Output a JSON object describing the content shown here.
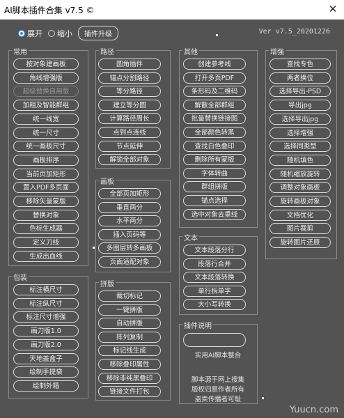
{
  "window": {
    "title": "AI脚本插件合集 v7.5 ©",
    "close_label": "✕"
  },
  "top": {
    "expand_label": "展开",
    "collapse_label": "缩小",
    "upgrade_label": "插件升级",
    "version": "Ver v7.5_20201226"
  },
  "groups": {
    "common": {
      "title": "常用",
      "items": [
        "按对象建画板",
        "角线增强版",
        "超级替换自用版",
        "加粗及智能群组",
        "统一线宽",
        "统一尺寸",
        "统一画板尺寸",
        "画板排序",
        "当前页加矩形",
        "置入PDF多页面",
        "移除矢量蒙版",
        "替换对象",
        "色标生成器",
        "定义刀线",
        "生成出血线"
      ]
    },
    "package": {
      "title": "包装",
      "items": [
        "标注横尺寸",
        "标注纵尺寸",
        "标注尺寸增强",
        "画刀版1.0",
        "画刀版2.0",
        "天地盖盒子",
        "绘制手提袋",
        "绘制外箱"
      ]
    },
    "path": {
      "title": "路径",
      "items": [
        "圆角插件",
        "锚点分割路径",
        "等分路径",
        "建立等分圆",
        "计算路径周长",
        "点到点连线",
        "节点延伸",
        "解锁全部对象"
      ]
    },
    "artboard": {
      "title": "画板",
      "items": [
        "全部页加矩形",
        "垂直两分",
        "水平两分",
        "插入页码等",
        "多图层转多画板",
        "页面适配对象"
      ]
    },
    "imposition": {
      "title": "拼版",
      "items": [
        "裁切标记",
        "一键拼版",
        "自动拼版",
        "阵列复制",
        "标记线生成",
        "移除叠印属性",
        "移除非纯黑叠印",
        "链接文件打包"
      ]
    },
    "other": {
      "title": "其他",
      "items": [
        "创建参考线",
        "打开多页PDF",
        "条形码及二维码",
        "解散全部群组",
        "批量替换链接图",
        "全部颜色转黑",
        "查找白色叠印",
        "删除所有蒙版",
        "字体转曲",
        "群组拼版",
        "锚点选择",
        "选中对象去重线"
      ]
    },
    "text": {
      "title": "文本",
      "items": [
        "文本段落分行",
        "段落行合并",
        "文本段落转换",
        "单行拆单字",
        "大小写转换"
      ]
    },
    "info": {
      "title": "插件说明",
      "note1": "实用AI脚本整合",
      "note2": [
        "脚本源于网上搜集",
        "版权归原作者所有",
        "盗卖传播者可耻"
      ]
    },
    "enhance": {
      "title": "增强",
      "items": [
        "查找专色",
        "两者换位",
        "选择导出-PSD",
        "导出jpg",
        "选择导出jpg",
        "选择增强",
        "选择同类型",
        "随机填色",
        "随机缩放旋转",
        "调整对象画板",
        "旋转画板对象",
        "文档优化",
        "图片裁剪",
        "旋转图片还原"
      ]
    }
  },
  "watermark": "Yuucn.com"
}
